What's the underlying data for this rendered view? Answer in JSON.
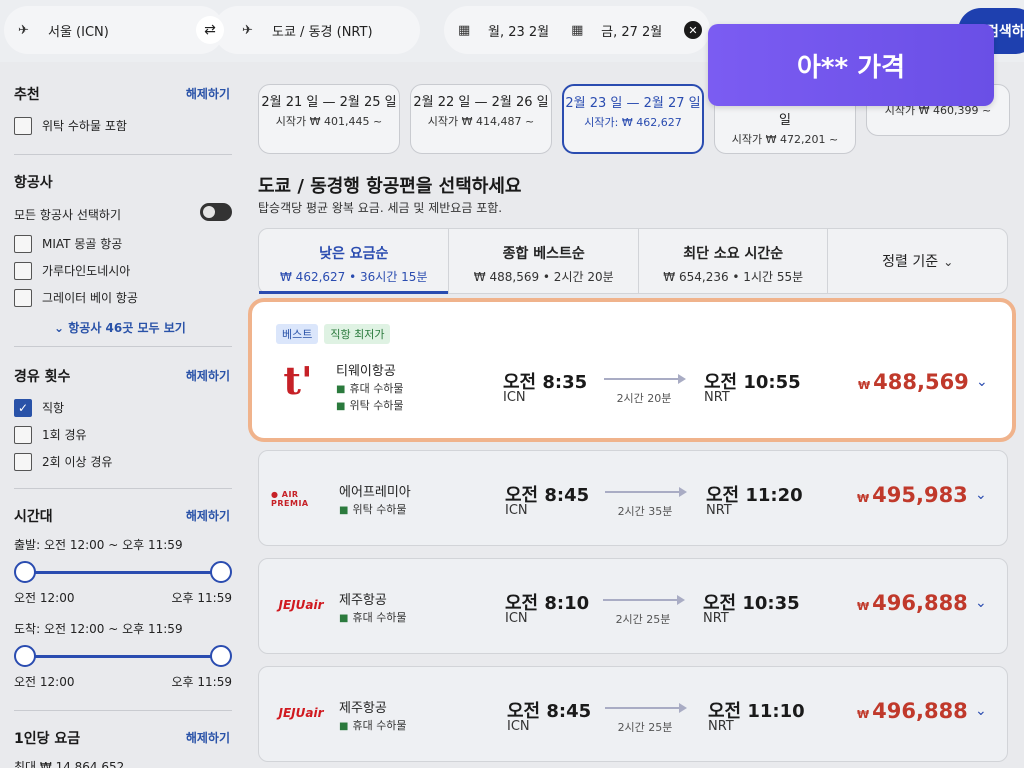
{
  "search": {
    "origin": "서울 (ICN)",
    "destination": "도쿄 / 동경 (NRT)",
    "depart_date": "월, 23 2월",
    "return_date": "금, 27 2월",
    "search_label": "검색하기"
  },
  "promo_label": "아** 가격",
  "sidebar": {
    "recommend": {
      "title": "추천",
      "clear": "해제하기",
      "items": [
        "위탁 수하물 포함"
      ]
    },
    "airlines": {
      "title": "항공사",
      "select_all": "모든 항공사 선택하기",
      "items": [
        "MIAT 몽골 항공",
        "가루다인도네시아",
        "그레이터 베이 항공"
      ],
      "see_all": "항공사 46곳 모두 보기"
    },
    "stops": {
      "title": "경유 횟수",
      "clear": "해제하기",
      "items": [
        "직항",
        "1회 경유",
        "2회 이상 경유"
      ],
      "checked_index": 0
    },
    "time": {
      "title": "시간대",
      "clear": "해제하기",
      "depart_label": "출발: 오전 12:00 ~ 오후 11:59",
      "arrive_label": "도착: 오전 12:00 ~ 오후 11:59",
      "min": "오전 12:00",
      "max": "오후 11:59"
    },
    "fare": {
      "title": "1인당 요금",
      "clear": "해제하기",
      "max_label": "최대 ₩ 14,864,652"
    }
  },
  "date_tabs": [
    {
      "dates": "2월 21 일 — 2월 25 일",
      "price": "시작가 ₩ 401,445 ~"
    },
    {
      "dates": "2월 22 일 — 2월 26 일",
      "price": "시작가 ₩ 414,487 ~"
    },
    {
      "dates": "2월 23 일 — 2월 27 일",
      "price": "시작가: ₩ 462,627"
    },
    {
      "dates": "일",
      "price": "시작가 ₩ 472,201 ~"
    },
    {
      "dates": "",
      "price": "시작가 ₩ 460,399 ~"
    }
  ],
  "heading": {
    "title": "도쿄 / 동경행 항공편을 선택하세요",
    "subtitle": "탑승객당 평균 왕복 요금. 세금 및 제반요금 포함."
  },
  "sort_tabs": [
    {
      "label": "낮은 요금순",
      "sub": "₩ 462,627 • 36시간 15분"
    },
    {
      "label": "종합 베스트순",
      "sub": "₩ 488,569 • 2시간 20분"
    },
    {
      "label": "최단 소요 시간순",
      "sub": "₩ 654,236 • 1시간 55분"
    },
    {
      "label": "정렬 기준",
      "sub": ""
    }
  ],
  "flights": [
    {
      "tags": [
        "베스트",
        "직항 최저가"
      ],
      "logo_text": "t'",
      "airline": "티웨이항공",
      "bags": [
        "휴대 수하물",
        "위탁 수하물"
      ],
      "dep_time": "오전 8:35",
      "dep_code": "ICN",
      "duration": "2시간 20분",
      "arr_time": "오전 10:55",
      "arr_code": "NRT",
      "price": "488,569"
    },
    {
      "tags": [],
      "logo_text": "● AIR PREMIA",
      "airline": "에어프레미아",
      "bags": [
        "위탁 수하물"
      ],
      "dep_time": "오전 8:45",
      "dep_code": "ICN",
      "duration": "2시간 35분",
      "arr_time": "오전 11:20",
      "arr_code": "NRT",
      "price": "495,983"
    },
    {
      "tags": [],
      "logo_text": "JEJUair",
      "airline": "제주항공",
      "bags": [
        "휴대 수하물"
      ],
      "dep_time": "오전 8:10",
      "dep_code": "ICN",
      "duration": "2시간 25분",
      "arr_time": "오전 10:35",
      "arr_code": "NRT",
      "price": "496,888"
    },
    {
      "tags": [],
      "logo_text": "JEJUair",
      "airline": "제주항공",
      "bags": [
        "휴대 수하물"
      ],
      "dep_time": "오전 8:45",
      "dep_code": "ICN",
      "duration": "2시간 25분",
      "arr_time": "오전 11:10",
      "arr_code": "NRT",
      "price": "496,888"
    }
  ],
  "currency_symbol": "₩"
}
